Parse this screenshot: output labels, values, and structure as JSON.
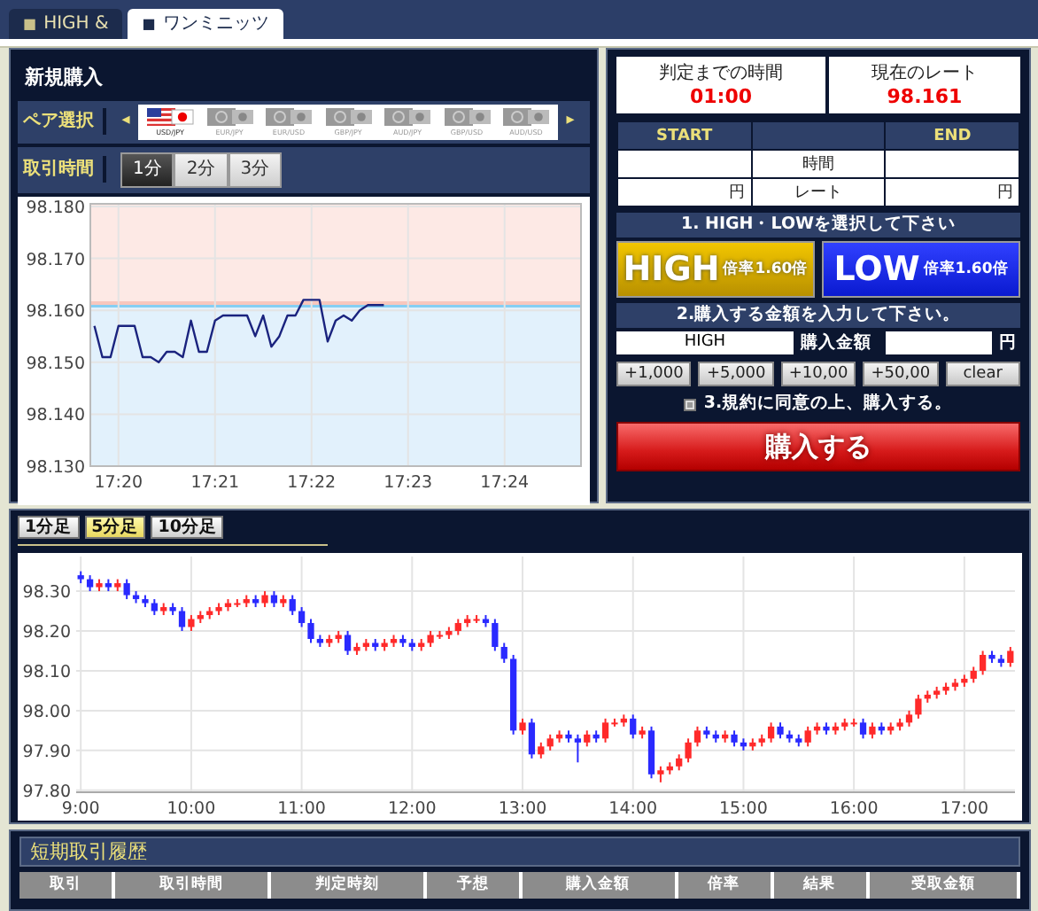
{
  "tabs": [
    {
      "marker": "■",
      "label": "HIGH &",
      "selected": false
    },
    {
      "marker": "■",
      "label": "ワンミニッツ",
      "selected": true
    }
  ],
  "purchase": {
    "title": "新規購入",
    "pair_label": "ペア選択",
    "prev": "◂",
    "next": "▸",
    "pairs": [
      {
        "label": "USD/JPY",
        "selected": true
      },
      {
        "label": "EUR/JPY",
        "selected": false
      },
      {
        "label": "EUR/USD",
        "selected": false
      },
      {
        "label": "GBP/JPY",
        "selected": false
      },
      {
        "label": "AUD/JPY",
        "selected": false
      },
      {
        "label": "GBP/USD",
        "selected": false
      },
      {
        "label": "AUD/USD",
        "selected": false
      }
    ],
    "time_label": "取引時間",
    "durations": [
      {
        "label": "1分",
        "selected": true
      },
      {
        "label": "2分",
        "selected": false
      },
      {
        "label": "3分",
        "selected": false
      }
    ],
    "chart_data": {
      "type": "line",
      "grid": true,
      "ylim": [
        98.13,
        98.1805
      ],
      "categories": [
        null,
        null,
        null,
        "17:20",
        null,
        null,
        null,
        null,
        null,
        null,
        null,
        null,
        null,
        null,
        null,
        "17:21",
        null,
        null,
        null,
        null,
        null,
        null,
        null,
        null,
        null,
        null,
        null,
        "17:22",
        null,
        null,
        null,
        null,
        null,
        null,
        null,
        null,
        null,
        null,
        null,
        "17:23",
        null,
        null,
        null,
        null,
        null,
        null,
        null,
        null,
        null,
        null,
        null,
        "17:24",
        null,
        null,
        null,
        null,
        null,
        null,
        null,
        null,
        null
      ],
      "yticks": [
        {
          "value": 98.13,
          "label": "98.130"
        },
        {
          "value": 98.14,
          "label": "98.140"
        },
        {
          "value": 98.15,
          "label": "98.150"
        },
        {
          "value": 98.16,
          "label": "98.160"
        },
        {
          "value": 98.17,
          "label": "98.170"
        },
        {
          "value": 98.18,
          "label": "98.180"
        }
      ],
      "values": [
        98.157,
        98.151,
        98.151,
        98.157,
        98.157,
        98.157,
        98.151,
        98.151,
        98.15,
        98.152,
        98.152,
        98.151,
        98.158,
        98.152,
        98.152,
        98.158,
        98.159,
        98.159,
        98.159,
        98.159,
        98.155,
        98.159,
        98.153,
        98.155,
        98.159,
        98.159,
        98.162,
        98.162,
        98.162,
        98.154,
        98.158,
        98.159,
        98.158,
        98.16,
        98.161,
        98.161,
        98.161,
        null,
        null,
        null,
        null,
        null,
        null,
        null,
        null,
        null,
        null,
        null,
        null,
        null,
        null,
        null,
        null,
        null,
        null,
        null,
        null,
        null,
        null,
        null,
        null
      ]
    }
  },
  "order": {
    "timer_label": "判定までの時間",
    "timer": "01:00",
    "rate_label": "現在のレート",
    "rate": "98.161",
    "start_label": "START",
    "end_label": "END",
    "time_label": "時間",
    "rate_row_label": "レート",
    "start_unit": "円",
    "end_unit": "円",
    "step1": "1. HIGH・LOWを選択して下さい",
    "high": {
      "label": "HIGH",
      "payout": "倍率1.60倍"
    },
    "low": {
      "label": "LOW",
      "payout": "倍率1.60倍"
    },
    "step2": "2.購入する金額を入力して下さい。",
    "direction_value": "HIGH",
    "amount_label": "購入金額",
    "amount_unit": "円",
    "amount_buttons": [
      "+1,000",
      "+5,000",
      "+10,00",
      "+50,00",
      "clear"
    ],
    "agree": {
      "label": "3.規約に同意の上、購入する。",
      "checked": true
    },
    "buy_button": "購入する"
  },
  "candles": {
    "tabs": [
      {
        "label": "1分足",
        "selected": false
      },
      {
        "label": "5分足",
        "selected": true
      },
      {
        "label": "10分足",
        "selected": false
      }
    ],
    "chart_data": {
      "type": "candlestick",
      "grid": true,
      "ylim": [
        97.795,
        98.387
      ],
      "categories": [
        "9:00",
        null,
        null,
        null,
        null,
        null,
        null,
        null,
        null,
        null,
        null,
        null,
        "10:00",
        null,
        null,
        null,
        null,
        null,
        null,
        null,
        null,
        null,
        null,
        null,
        "11:00",
        null,
        null,
        null,
        null,
        null,
        null,
        null,
        null,
        null,
        null,
        null,
        "12:00",
        null,
        null,
        null,
        null,
        null,
        null,
        null,
        null,
        null,
        null,
        null,
        "13:00",
        null,
        null,
        null,
        null,
        null,
        null,
        null,
        null,
        null,
        null,
        null,
        "14:00",
        null,
        null,
        null,
        null,
        null,
        null,
        null,
        null,
        null,
        null,
        null,
        "15:00",
        null,
        null,
        null,
        null,
        null,
        null,
        null,
        null,
        null,
        null,
        null,
        "16:00",
        null,
        null,
        null,
        null,
        null,
        null,
        null,
        null,
        null,
        null,
        null,
        "17:00",
        null,
        null,
        null,
        null,
        null
      ],
      "yticks": [
        {
          "value": 97.8,
          "label": "97.80"
        },
        {
          "value": 97.9,
          "label": "97.90"
        },
        {
          "value": 98,
          "label": "98.00"
        },
        {
          "value": 98.1,
          "label": "98.10"
        },
        {
          "value": 98.2,
          "label": "98.20"
        },
        {
          "value": 98.3,
          "label": "98.30"
        }
      ],
      "ohlc": [
        [
          98.34,
          98.35,
          98.32,
          98.33
        ],
        [
          98.33,
          98.34,
          98.3,
          98.31
        ],
        [
          98.31,
          98.33,
          98.3,
          98.32
        ],
        [
          98.32,
          98.33,
          98.3,
          98.31
        ],
        [
          98.31,
          98.33,
          98.3,
          98.32
        ],
        [
          98.32,
          98.33,
          98.28,
          98.29
        ],
        [
          98.29,
          98.3,
          98.27,
          98.28
        ],
        [
          98.28,
          98.29,
          98.26,
          98.27
        ],
        [
          98.27,
          98.28,
          98.24,
          98.25
        ],
        [
          98.25,
          98.27,
          98.24,
          98.26
        ],
        [
          98.26,
          98.27,
          98.24,
          98.25
        ],
        [
          98.25,
          98.26,
          98.2,
          98.21
        ],
        [
          98.21,
          98.24,
          98.2,
          98.23
        ],
        [
          98.23,
          98.25,
          98.22,
          98.24
        ],
        [
          98.24,
          98.26,
          98.23,
          98.25
        ],
        [
          98.25,
          98.27,
          98.24,
          98.26
        ],
        [
          98.26,
          98.28,
          98.25,
          98.27
        ],
        [
          98.27,
          98.28,
          98.26,
          98.27
        ],
        [
          98.27,
          98.29,
          98.26,
          98.28
        ],
        [
          98.28,
          98.29,
          98.26,
          98.27
        ],
        [
          98.27,
          98.3,
          98.26,
          98.29
        ],
        [
          98.29,
          98.3,
          98.26,
          98.27
        ],
        [
          98.27,
          98.29,
          98.26,
          98.28
        ],
        [
          98.28,
          98.29,
          98.24,
          98.25
        ],
        [
          98.25,
          98.26,
          98.21,
          98.22
        ],
        [
          98.22,
          98.23,
          98.17,
          98.18
        ],
        [
          98.18,
          98.19,
          98.16,
          98.17
        ],
        [
          98.17,
          98.19,
          98.16,
          98.18
        ],
        [
          98.18,
          98.2,
          98.17,
          98.19
        ],
        [
          98.19,
          98.2,
          98.14,
          98.15
        ],
        [
          98.15,
          98.17,
          98.14,
          98.16
        ],
        [
          98.16,
          98.18,
          98.15,
          98.17
        ],
        [
          98.17,
          98.18,
          98.15,
          98.16
        ],
        [
          98.16,
          98.18,
          98.15,
          98.17
        ],
        [
          98.17,
          98.19,
          98.16,
          98.18
        ],
        [
          98.18,
          98.19,
          98.16,
          98.17
        ],
        [
          98.17,
          98.18,
          98.15,
          98.16
        ],
        [
          98.16,
          98.18,
          98.15,
          98.17
        ],
        [
          98.17,
          98.2,
          98.16,
          98.19
        ],
        [
          98.19,
          98.2,
          98.18,
          98.19
        ],
        [
          98.19,
          98.21,
          98.18,
          98.2
        ],
        [
          98.2,
          98.23,
          98.19,
          98.22
        ],
        [
          98.22,
          98.24,
          98.21,
          98.23
        ],
        [
          98.23,
          98.24,
          98.22,
          98.23
        ],
        [
          98.23,
          98.24,
          98.21,
          98.22
        ],
        [
          98.22,
          98.23,
          98.15,
          98.16
        ],
        [
          98.16,
          98.17,
          98.12,
          98.13
        ],
        [
          98.13,
          98.14,
          97.94,
          97.95
        ],
        [
          97.95,
          97.98,
          97.94,
          97.97
        ],
        [
          97.97,
          97.98,
          97.88,
          97.89
        ],
        [
          97.89,
          97.92,
          97.88,
          97.91
        ],
        [
          97.91,
          97.94,
          97.9,
          97.93
        ],
        [
          97.93,
          97.95,
          97.92,
          97.94
        ],
        [
          97.94,
          97.95,
          97.92,
          97.93
        ],
        [
          97.93,
          97.94,
          97.87,
          97.92
        ],
        [
          97.92,
          97.95,
          97.91,
          97.94
        ],
        [
          97.94,
          97.95,
          97.92,
          97.93
        ],
        [
          97.93,
          97.98,
          97.92,
          97.97
        ],
        [
          97.97,
          97.98,
          97.96,
          97.97
        ],
        [
          97.97,
          97.99,
          97.96,
          97.98
        ],
        [
          97.98,
          97.99,
          97.93,
          97.94
        ],
        [
          97.94,
          97.96,
          97.93,
          97.95
        ],
        [
          97.95,
          97.96,
          97.83,
          97.84
        ],
        [
          97.84,
          97.86,
          97.82,
          97.85
        ],
        [
          97.85,
          97.87,
          97.84,
          97.86
        ],
        [
          97.86,
          97.89,
          97.85,
          97.88
        ],
        [
          97.88,
          97.93,
          97.87,
          97.92
        ],
        [
          97.92,
          97.96,
          97.91,
          97.95
        ],
        [
          97.95,
          97.96,
          97.93,
          97.94
        ],
        [
          97.94,
          97.95,
          97.92,
          97.93
        ],
        [
          97.93,
          97.95,
          97.92,
          97.94
        ],
        [
          97.94,
          97.95,
          97.91,
          97.92
        ],
        [
          97.92,
          97.93,
          97.9,
          97.91
        ],
        [
          97.91,
          97.93,
          97.9,
          97.92
        ],
        [
          97.92,
          97.94,
          97.91,
          97.93
        ],
        [
          97.93,
          97.97,
          97.92,
          97.96
        ],
        [
          97.96,
          97.97,
          97.93,
          97.94
        ],
        [
          97.94,
          97.95,
          97.92,
          97.93
        ],
        [
          97.93,
          97.94,
          97.91,
          97.92
        ],
        [
          97.92,
          97.96,
          97.91,
          97.95
        ],
        [
          97.95,
          97.97,
          97.94,
          97.96
        ],
        [
          97.96,
          97.97,
          97.94,
          97.95
        ],
        [
          97.95,
          97.97,
          97.94,
          97.96
        ],
        [
          97.96,
          97.98,
          97.95,
          97.97
        ],
        [
          97.97,
          97.98,
          97.96,
          97.97
        ],
        [
          97.97,
          97.98,
          97.93,
          97.94
        ],
        [
          97.94,
          97.97,
          97.93,
          97.96
        ],
        [
          97.96,
          97.97,
          97.94,
          97.95
        ],
        [
          97.95,
          97.97,
          97.94,
          97.96
        ],
        [
          97.96,
          97.98,
          97.95,
          97.97
        ],
        [
          97.97,
          98.0,
          97.96,
          97.99
        ],
        [
          97.99,
          98.04,
          97.98,
          98.03
        ],
        [
          98.03,
          98.05,
          98.02,
          98.04
        ],
        [
          98.04,
          98.06,
          98.03,
          98.05
        ],
        [
          98.05,
          98.07,
          98.04,
          98.06
        ],
        [
          98.06,
          98.08,
          98.05,
          98.07
        ],
        [
          98.07,
          98.09,
          98.06,
          98.08
        ],
        [
          98.08,
          98.11,
          98.07,
          98.1
        ],
        [
          98.1,
          98.15,
          98.09,
          98.14
        ],
        [
          98.14,
          98.15,
          98.12,
          98.13
        ],
        [
          98.13,
          98.14,
          98.11,
          98.12
        ],
        [
          98.12,
          98.16,
          98.11,
          98.15
        ]
      ]
    }
  },
  "history": {
    "title": "短期取引履歴",
    "columns": [
      "取引",
      "取引時間",
      "判定時刻",
      "予想",
      "購入金額",
      "倍率",
      "結果",
      "受取金額"
    ]
  }
}
